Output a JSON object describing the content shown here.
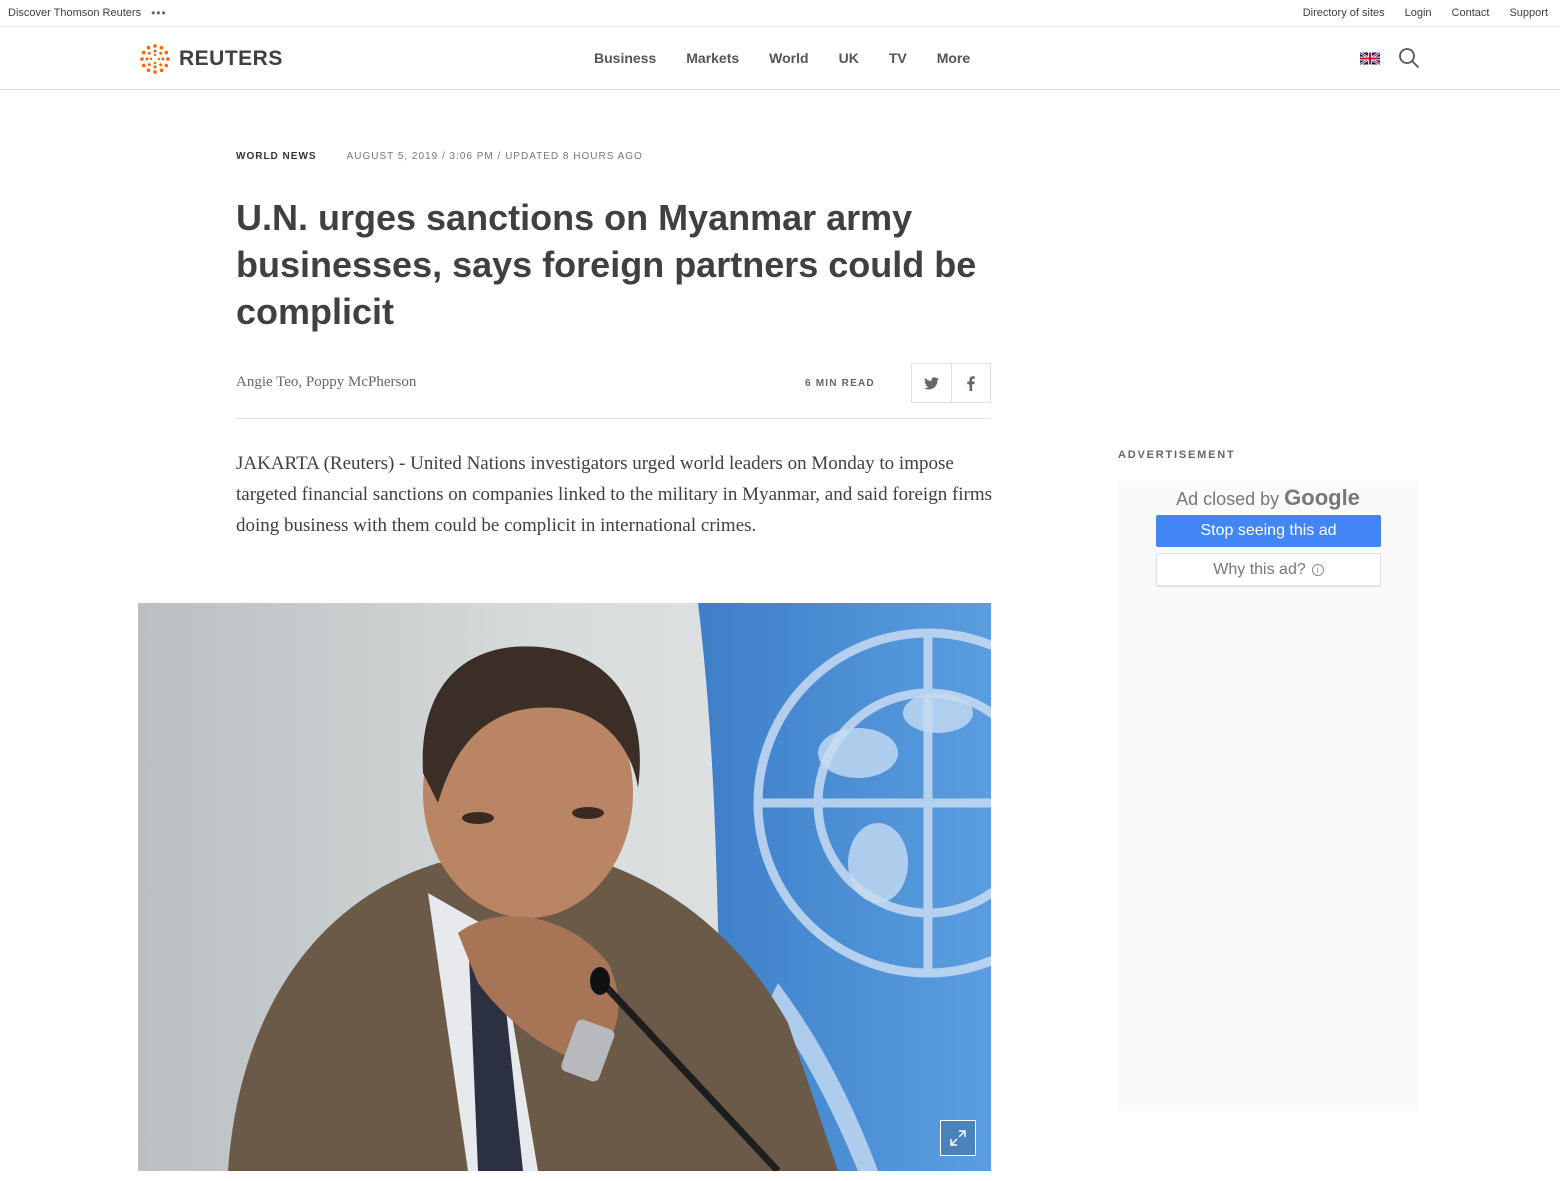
{
  "utility": {
    "discover": "Discover Thomson Reuters",
    "more_dots": "•••",
    "links": [
      "Directory of sites",
      "Login",
      "Contact",
      "Support"
    ]
  },
  "header": {
    "logo_text": "REUTERS",
    "nav": [
      "Business",
      "Markets",
      "World",
      "UK",
      "TV",
      "More"
    ],
    "icons": {
      "flag": "uk-flag-icon",
      "search": "search-icon"
    }
  },
  "article": {
    "section": "WORLD NEWS",
    "dateline": "AUGUST 5, 2019 / 3:06 PM / UPDATED 8 HOURS AGO",
    "headline": "U.N. urges sanctions on Myanmar army businesses, says foreign partners could be complicit",
    "byline": "Angie Teo, Poppy McPherson",
    "read_time": "6 MIN READ",
    "share_icons": [
      "twitter-icon",
      "facebook-icon"
    ],
    "lead": "JAKARTA (Reuters) - United Nations investigators urged world leaders on Monday to impose targeted financial sanctions on companies linked to the military in Myanmar, and said foreign firms doing business with them could be complicit in international crimes."
  },
  "ad": {
    "label": "ADVERTISEMENT",
    "closed_by": "Ad closed by",
    "google": "Google",
    "stop_button": "Stop seeing this ad",
    "why_button": "Why this ad?"
  },
  "colors": {
    "brand_orange": "#fa6400",
    "google_blue": "#4285f4",
    "un_blue": "#4a90d9"
  }
}
